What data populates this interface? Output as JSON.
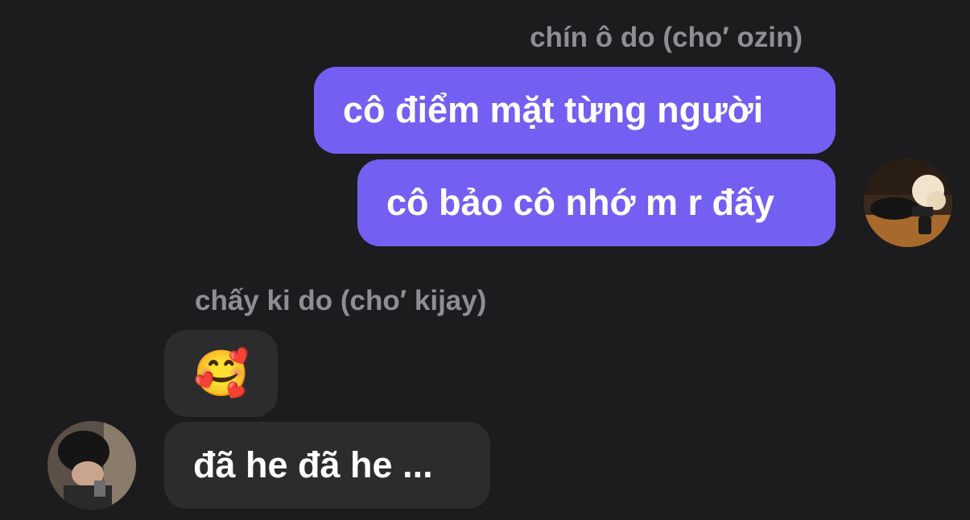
{
  "chat": {
    "outgoing": {
      "sender": "chín ô do (cho′ ozin)",
      "messages": [
        "cô điểm mặt từng người",
        "cô bảo cô nhớ m r đấy"
      ]
    },
    "incoming": {
      "sender": "chấy ki do (cho′ kijay)",
      "messages": [
        "🥰",
        "đã he đã he ..."
      ]
    }
  },
  "colors": {
    "background": "#1c1c1f",
    "outgoing_bubble": "#7360f2",
    "incoming_bubble": "#2c2c2e",
    "sender_name": "#8e8e93"
  }
}
